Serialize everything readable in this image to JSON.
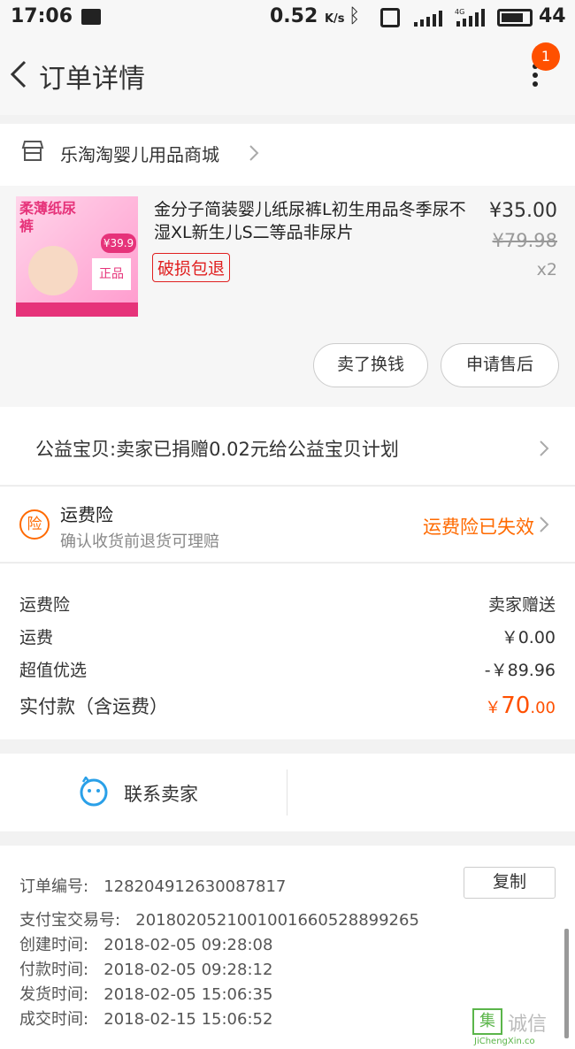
{
  "status_bar": {
    "time": "17:06",
    "speed_value": "0.52",
    "speed_unit": "K/s",
    "network": "4G",
    "battery": "44"
  },
  "nav": {
    "title": "订单详情",
    "badge": "1"
  },
  "shop": {
    "name": "乐淘淘婴儿用品商城"
  },
  "product": {
    "name": "金分子简装婴儿纸尿裤L初生用品冬季尿不湿XL新生儿S二等品非尿片",
    "tag": "破损包退",
    "price": "¥35.00",
    "original_price": "¥79.98",
    "quantity": "x2",
    "thumb_text": "柔薄纸尿裤",
    "thumb_price": "¥39.9",
    "thumb_badge": "正品"
  },
  "actions": {
    "sell_label": "卖了换钱",
    "after_sale_label": "申请售后"
  },
  "charity": {
    "text": "公益宝贝:卖家已捐赠0.02元给公益宝贝计划"
  },
  "insurance": {
    "icon_text": "险",
    "title": "运费险",
    "subtitle": "确认收货前退货可理赔",
    "status": "运费险已失效"
  },
  "fees": [
    {
      "label": "运费险",
      "value": "卖家赠送"
    },
    {
      "label": "运费",
      "value": "￥0.00"
    },
    {
      "label": "超值优选",
      "value": "-￥89.96"
    }
  ],
  "total": {
    "label": "实付款（含运费）",
    "symbol": "￥",
    "amount_int": "70",
    "amount_dec": ".00"
  },
  "contact": {
    "label": "联系卖家"
  },
  "order_info": {
    "copy_label": "复制",
    "rows": [
      {
        "label": "订单编号:",
        "value": "128204912630087817"
      },
      {
        "label": "支付宝交易号:",
        "value": "2018020521001001660528899265"
      },
      {
        "label": "创建时间:",
        "value": "2018-02-05 09:28:08"
      },
      {
        "label": "付款时间:",
        "value": "2018-02-05 09:28:12"
      },
      {
        "label": "发货时间:",
        "value": "2018-02-05 15:06:35"
      },
      {
        "label": "成交时间:",
        "value": "2018-02-15 15:06:52"
      }
    ]
  },
  "watermark": {
    "box": "集",
    "text": "诚信",
    "url": "JiChengXin.co"
  },
  "colors": {
    "accent": "#ff5000",
    "insurance_orange": "#ff6a00",
    "tag_red": "#e02020"
  }
}
